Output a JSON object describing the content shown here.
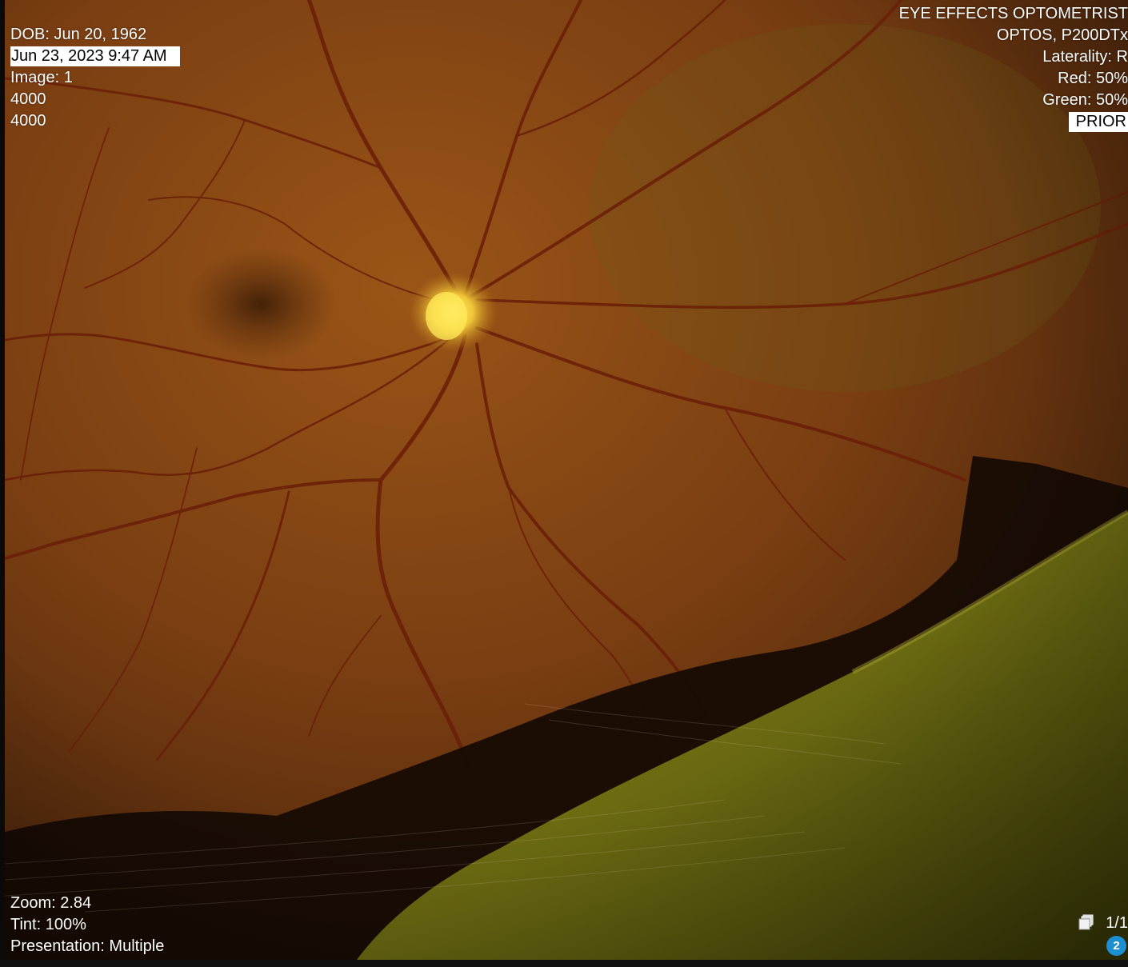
{
  "top_left": {
    "dob": "DOB: Jun 20, 1962",
    "study_datetime": "Jun 23, 2023 9:47 AM",
    "image": "Image: 1",
    "rows": "4000",
    "cols": "4000"
  },
  "top_right": {
    "institution": "EYE EFFECTS OPTOMETRIST",
    "device": "OPTOS, P200DTx",
    "laterality": "Laterality: R",
    "red": "Red: 50%",
    "green": "Green: 50%",
    "prior": "PRIOR"
  },
  "bottom_left": {
    "zoom": "Zoom: 2.84",
    "tint": "Tint: 100%",
    "presentation": "Presentation: Multiple"
  },
  "bottom_right": {
    "frame_counter": "1/1",
    "badge_count": "2",
    "stack_icon": "image-stack-icon"
  },
  "colors": {
    "background": "#000000",
    "overlay_text": "#ffffff",
    "badge": "#1c8fd1",
    "fundus_base": "#7a3c12",
    "optic_disc": "#f2d43a"
  }
}
